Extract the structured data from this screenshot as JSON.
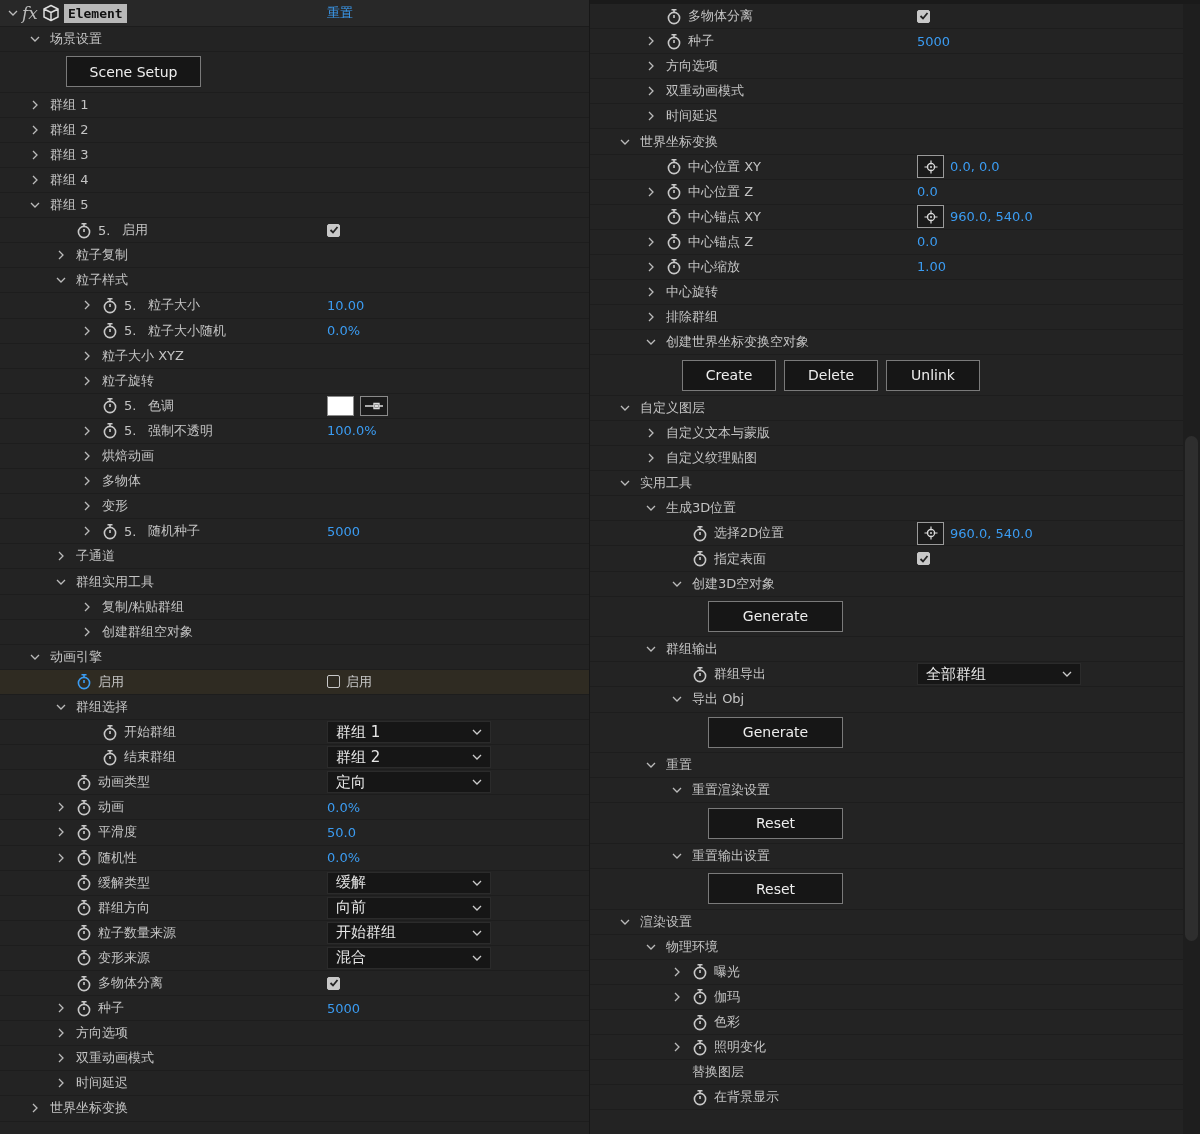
{
  "left": {
    "header": {
      "expanded": true,
      "effect_mark": "fx",
      "title": "Element",
      "reset_link": "重置"
    },
    "tree": [
      {
        "kind": "group",
        "label": "场景设置",
        "expanded": true,
        "selected": false,
        "children": [
          {
            "kind": "button",
            "buttons": [
              "Scene Setup"
            ]
          }
        ]
      },
      {
        "kind": "group",
        "label": "群组 1",
        "expanded": false,
        "selected": false
      },
      {
        "kind": "group",
        "label": "群组 2",
        "expanded": false,
        "selected": false
      },
      {
        "kind": "group",
        "label": "群组 3",
        "expanded": false,
        "selected": false
      },
      {
        "kind": "group",
        "label": "群组 4",
        "expanded": false,
        "selected": false
      },
      {
        "kind": "group",
        "label": "群组 5",
        "expanded": true,
        "selected": false,
        "children": [
          {
            "kind": "property",
            "prefix": "5.",
            "label": "启用",
            "selected": false,
            "value": {
              "kind": "checkbox",
              "checked": true
            }
          },
          {
            "kind": "group",
            "label": "粒子复制",
            "expanded": false,
            "selected": false
          },
          {
            "kind": "group",
            "label": "粒子样式",
            "expanded": true,
            "selected": false,
            "children": [
              {
                "kind": "property",
                "prefix": "5.",
                "label": "粒子大小",
                "expanded": false,
                "selected": false,
                "value": {
                  "kind": "number",
                  "text": "10.00"
                }
              },
              {
                "kind": "property",
                "prefix": "5.",
                "label": "粒子大小随机",
                "expanded": false,
                "selected": false,
                "value": {
                  "kind": "number",
                  "text": "0.0%"
                }
              },
              {
                "kind": "group",
                "label": "粒子大小 XYZ",
                "expanded": false,
                "selected": false
              },
              {
                "kind": "group",
                "label": "粒子旋转",
                "expanded": false,
                "selected": false
              },
              {
                "kind": "property",
                "prefix": "5.",
                "label": "色调",
                "selected": false,
                "value": {
                  "kind": "color",
                  "color": "#ffffff"
                }
              },
              {
                "kind": "property",
                "prefix": "5.",
                "label": "强制不透明",
                "expanded": false,
                "selected": false,
                "value": {
                  "kind": "number",
                  "text": "100.0%"
                }
              },
              {
                "kind": "group",
                "label": "烘焙动画",
                "expanded": false,
                "selected": false
              },
              {
                "kind": "group",
                "label": "多物体",
                "expanded": false,
                "selected": false
              },
              {
                "kind": "group",
                "label": "变形",
                "expanded": false,
                "selected": false
              },
              {
                "kind": "property",
                "prefix": "5.",
                "label": "随机种子",
                "expanded": false,
                "selected": false,
                "value": {
                  "kind": "number",
                  "text": "5000"
                }
              }
            ]
          },
          {
            "kind": "group",
            "label": "子通道",
            "expanded": false,
            "selected": false
          },
          {
            "kind": "group",
            "label": "群组实用工具",
            "expanded": true,
            "selected": false,
            "children": [
              {
                "kind": "group",
                "label": "复制/粘贴群组",
                "expanded": false,
                "selected": false
              },
              {
                "kind": "group",
                "label": "创建群组空对象",
                "expanded": false,
                "selected": false
              }
            ]
          }
        ]
      },
      {
        "kind": "group",
        "label": "动画引擎",
        "expanded": true,
        "selected": false,
        "children": [
          {
            "kind": "property",
            "label": "启用",
            "selected": true,
            "value": {
              "kind": "checkbox",
              "checked": false,
              "label": "启用"
            }
          },
          {
            "kind": "group",
            "label": "群组选择",
            "expanded": true,
            "selected": false,
            "children": [
              {
                "kind": "property",
                "label": "开始群组",
                "selected": false,
                "value": {
                  "kind": "dropdown",
                  "text": "群组 1"
                }
              },
              {
                "kind": "property",
                "label": "结束群组",
                "selected": false,
                "value": {
                  "kind": "dropdown",
                  "text": "群组 2"
                }
              }
            ]
          },
          {
            "kind": "property",
            "label": "动画类型",
            "selected": false,
            "value": {
              "kind": "dropdown",
              "text": "定向"
            }
          },
          {
            "kind": "property",
            "label": "动画",
            "expanded": false,
            "selected": false,
            "value": {
              "kind": "number",
              "text": "0.0%"
            }
          },
          {
            "kind": "property",
            "label": "平滑度",
            "expanded": false,
            "selected": false,
            "value": {
              "kind": "number",
              "text": "50.0"
            }
          },
          {
            "kind": "property",
            "label": "随机性",
            "expanded": false,
            "selected": false,
            "value": {
              "kind": "number",
              "text": "0.0%"
            }
          },
          {
            "kind": "property",
            "label": "缓解类型",
            "selected": false,
            "value": {
              "kind": "dropdown",
              "text": "缓解"
            }
          },
          {
            "kind": "property",
            "label": "群组方向",
            "selected": false,
            "value": {
              "kind": "dropdown",
              "text": "向前"
            }
          },
          {
            "kind": "property",
            "label": "粒子数量来源",
            "selected": false,
            "value": {
              "kind": "dropdown",
              "text": "开始群组"
            }
          },
          {
            "kind": "property",
            "label": "变形来源",
            "selected": false,
            "value": {
              "kind": "dropdown",
              "text": "混合"
            }
          },
          {
            "kind": "property",
            "label": "多物体分离",
            "selected": false,
            "value": {
              "kind": "checkbox",
              "checked": true
            }
          },
          {
            "kind": "property",
            "label": "种子",
            "expanded": false,
            "selected": false,
            "value": {
              "kind": "number",
              "text": "5000"
            }
          },
          {
            "kind": "group",
            "label": "方向选项",
            "expanded": false,
            "selected": false
          },
          {
            "kind": "group",
            "label": "双重动画模式",
            "expanded": false,
            "selected": false
          },
          {
            "kind": "group",
            "label": "时间延迟",
            "expanded": false,
            "selected": false
          }
        ]
      },
      {
        "kind": "group",
        "label": "世界坐标变换",
        "expanded": false,
        "selected": false
      }
    ]
  },
  "right": {
    "tree": [
      {
        "kind": "offscreen",
        "children": [
          {
            "kind": "property",
            "label": "多物体分离",
            "selected": false,
            "value": {
              "kind": "checkbox",
              "checked": true
            }
          },
          {
            "kind": "property",
            "label": "种子",
            "expanded": false,
            "selected": false,
            "value": {
              "kind": "number",
              "text": "5000"
            }
          },
          {
            "kind": "group",
            "label": "方向选项",
            "expanded": false,
            "selected": false
          },
          {
            "kind": "group",
            "label": "双重动画模式",
            "expanded": false,
            "selected": false
          },
          {
            "kind": "group",
            "label": "时间延迟",
            "expanded": false,
            "selected": false
          }
        ]
      },
      {
        "kind": "group",
        "label": "世界坐标变换",
        "expanded": true,
        "selected": false,
        "children": [
          {
            "kind": "property",
            "label": "中心位置 XY",
            "selected": false,
            "value": {
              "kind": "point",
              "text": "0.0, 0.0"
            }
          },
          {
            "kind": "property",
            "label": "中心位置 Z",
            "expanded": false,
            "selected": false,
            "value": {
              "kind": "number",
              "text": "0.0"
            }
          },
          {
            "kind": "property",
            "label": "中心锚点 XY",
            "selected": false,
            "value": {
              "kind": "point",
              "text": "960.0, 540.0"
            }
          },
          {
            "kind": "property",
            "label": "中心锚点 Z",
            "expanded": false,
            "selected": false,
            "value": {
              "kind": "number",
              "text": "0.0"
            }
          },
          {
            "kind": "property",
            "label": "中心缩放",
            "expanded": false,
            "selected": false,
            "value": {
              "kind": "number",
              "text": "1.00"
            }
          },
          {
            "kind": "group",
            "label": "中心旋转",
            "expanded": false,
            "selected": false
          },
          {
            "kind": "group",
            "label": "排除群组",
            "expanded": false,
            "selected": false
          },
          {
            "kind": "group",
            "label": "创建世界坐标变换空对象",
            "expanded": true,
            "selected": false,
            "children": [
              {
                "kind": "button",
                "buttons": [
                  "Create",
                  "Delete",
                  "Unlink"
                ]
              }
            ]
          }
        ]
      },
      {
        "kind": "group",
        "label": "自定义图层",
        "expanded": true,
        "selected": false,
        "children": [
          {
            "kind": "group",
            "label": "自定义文本与蒙版",
            "expanded": false,
            "selected": false
          },
          {
            "kind": "group",
            "label": "自定义纹理贴图",
            "expanded": false,
            "selected": false
          }
        ]
      },
      {
        "kind": "group",
        "label": "实用工具",
        "expanded": true,
        "selected": false,
        "children": [
          {
            "kind": "group",
            "label": "生成3D位置",
            "expanded": true,
            "selected": false,
            "children": [
              {
                "kind": "property",
                "label": "选择2D位置",
                "selected": false,
                "value": {
                  "kind": "point",
                  "text": "960.0, 540.0"
                }
              },
              {
                "kind": "property",
                "label": "指定表面",
                "selected": false,
                "value": {
                  "kind": "checkbox",
                  "checked": true
                }
              },
              {
                "kind": "group",
                "label": "创建3D空对象",
                "expanded": true,
                "selected": false,
                "children": [
                  {
                    "kind": "button",
                    "buttons": [
                      "Generate"
                    ]
                  }
                ]
              }
            ]
          },
          {
            "kind": "group",
            "label": "群组输出",
            "expanded": true,
            "selected": false,
            "children": [
              {
                "kind": "property",
                "label": "群组导出",
                "selected": false,
                "value": {
                  "kind": "dropdown",
                  "text": "全部群组"
                }
              },
              {
                "kind": "group",
                "label": "导出 Obj",
                "expanded": true,
                "selected": false,
                "children": [
                  {
                    "kind": "button",
                    "buttons": [
                      "Generate"
                    ]
                  }
                ]
              }
            ]
          },
          {
            "kind": "group",
            "label": "重置",
            "expanded": true,
            "selected": false,
            "children": [
              {
                "kind": "group",
                "label": "重置渲染设置",
                "expanded": true,
                "selected": false,
                "children": [
                  {
                    "kind": "button",
                    "buttons": [
                      "Reset"
                    ]
                  }
                ]
              },
              {
                "kind": "group",
                "label": "重置输出设置",
                "expanded": true,
                "selected": false,
                "children": [
                  {
                    "kind": "button",
                    "buttons": [
                      "Reset"
                    ]
                  }
                ]
              }
            ]
          }
        ]
      },
      {
        "kind": "group",
        "label": "渲染设置",
        "expanded": true,
        "selected": false,
        "children": [
          {
            "kind": "group",
            "label": "物理环境",
            "expanded": true,
            "selected": false,
            "children": [
              {
                "kind": "property",
                "label": "曝光",
                "expanded": false,
                "selected": false
              },
              {
                "kind": "property",
                "label": "伽玛",
                "expanded": false,
                "selected": false
              },
              {
                "kind": "property",
                "label": "色彩",
                "selected": false
              },
              {
                "kind": "property",
                "label": "照明变化",
                "expanded": false,
                "selected": false
              }
            ]
          },
          {
            "kind": "offscreen",
            "children": [
              {
                "kind": "heading",
                "label": "替换图层",
                "selected": false
              },
              {
                "kind": "property",
                "label": "在背景显示",
                "selected": false
              }
            ]
          }
        ]
      }
    ]
  }
}
